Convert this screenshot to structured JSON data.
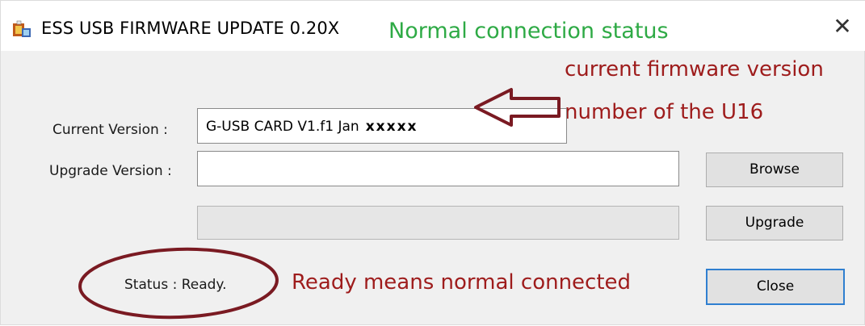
{
  "window": {
    "title": "ESS USB FIRMWARE UPDATE 0.20X",
    "close_glyph": "✕"
  },
  "annotations": {
    "connection": "Normal connection status",
    "firmware_line1": "current firmware version",
    "firmware_line2": "number of the U16",
    "ready_note": "Ready means normal connected"
  },
  "form": {
    "current_version_label": "Current Version :",
    "current_version_value": "G-USB CARD V1.f1 Jan",
    "current_version_masked": "xxxxx",
    "upgrade_version_label": "Upgrade Version :",
    "upgrade_version_value": "",
    "status_label": "Status :",
    "status_value": "Ready."
  },
  "buttons": {
    "browse": "Browse",
    "upgrade": "Upgrade",
    "close": "Close"
  },
  "colors": {
    "annotation_green": "#2eaa45",
    "annotation_red": "#9e1c1c",
    "arrow_and_circle": "#7a1a22",
    "focus_border": "#2f7fd0"
  },
  "icons": {
    "app": "usb-firmware-app-icon",
    "close": "close-icon",
    "arrow": "left-arrow-annotation-icon"
  }
}
